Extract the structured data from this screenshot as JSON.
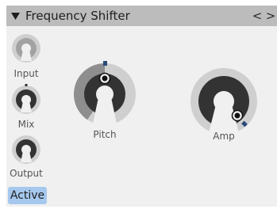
{
  "device": {
    "title": "Frequency Shifter",
    "collapse_glyph": "▼",
    "nav_prev": "<",
    "nav_next": ">"
  },
  "knobs": {
    "input": {
      "label": "Input",
      "value": 0.5
    },
    "mix": {
      "label": "Mix",
      "value": 0.5
    },
    "output": {
      "label": "Output",
      "value": 0.5
    },
    "pitch": {
      "label": "Pitch",
      "value": 0.48
    },
    "amp": {
      "label": "Amp",
      "value": 0.86
    }
  },
  "active_button": {
    "label": "Active",
    "state": "on"
  },
  "colors": {
    "titlebar": "#bcbcbc",
    "panel": "#f0f0f0",
    "knob_track": "#cfcfcf",
    "knob_fill": "#8e8e8e",
    "knob_dark": "#333333",
    "knob_inactive": "#a2a2a2",
    "indicator": "#2c4a7a",
    "active_button": "#a6c8ee"
  },
  "icons": {
    "collapse": "triangle-down-icon",
    "prev": "chevron-left-icon",
    "next": "chevron-right-icon"
  }
}
